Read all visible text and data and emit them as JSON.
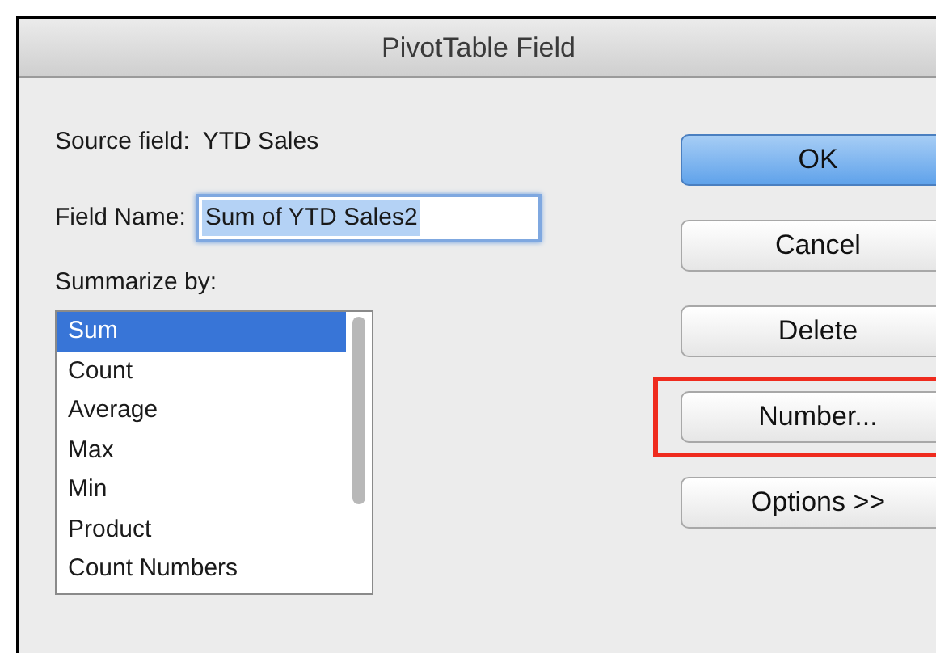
{
  "window": {
    "title": "PivotTable Field"
  },
  "source_field": {
    "label": "Source field:",
    "value": "YTD Sales"
  },
  "field_name": {
    "label": "Field Name:",
    "value": "Sum of YTD Sales2",
    "text_selected": true
  },
  "summarize_by": {
    "label": "Summarize by:",
    "items": [
      {
        "label": "Sum",
        "selected": true
      },
      {
        "label": "Count",
        "selected": false
      },
      {
        "label": "Average",
        "selected": false
      },
      {
        "label": "Max",
        "selected": false
      },
      {
        "label": "Min",
        "selected": false
      },
      {
        "label": "Product",
        "selected": false
      },
      {
        "label": "Count Numbers",
        "selected": false
      }
    ]
  },
  "buttons": [
    {
      "label": "OK",
      "default": true,
      "highlighted": false
    },
    {
      "label": "Cancel",
      "default": false,
      "highlighted": false
    },
    {
      "label": "Delete",
      "default": false,
      "highlighted": false
    },
    {
      "label": "Number...",
      "default": false,
      "highlighted": true
    },
    {
      "label": "Options >>",
      "default": false,
      "highlighted": false
    }
  ]
}
